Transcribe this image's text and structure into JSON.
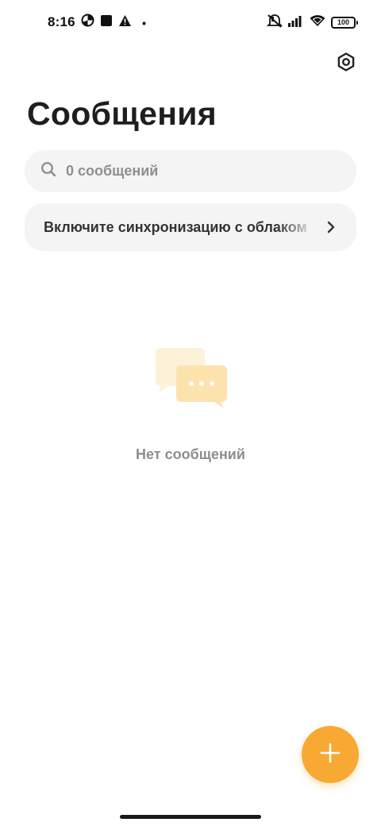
{
  "status_bar": {
    "time": "8:16",
    "battery_level": "100",
    "icons": [
      "data-saver-icon",
      "notification-square-icon",
      "warning-icon",
      "dot-icon",
      "silent-icon",
      "signal-icon",
      "wifi-icon",
      "battery-icon"
    ]
  },
  "header": {
    "title": "Сообщения",
    "settings_icon": "settings-hexagon-icon"
  },
  "search": {
    "text": "0 сообщений",
    "icon": "search-icon"
  },
  "sync_banner": {
    "text": "Включите синхронизацию с облаком",
    "icon": "chevron-right-icon"
  },
  "empty_state": {
    "text": "Нет сообщений",
    "illustration": "chat-bubbles-icon"
  },
  "fab": {
    "icon": "plus-icon"
  },
  "colors": {
    "accent": "#f7a933",
    "surface": "#f4f4f4",
    "muted_text": "#8e8e8e",
    "illustration_light": "#fdf1d8",
    "illustration": "#fce3ae"
  }
}
